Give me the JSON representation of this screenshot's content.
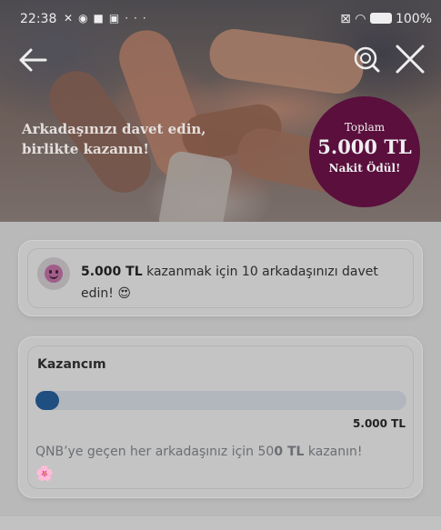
{
  "status_bar": {
    "time": "22:38",
    "notification_icons": [
      "mute-icon",
      "telegram-icon",
      "app-icon",
      "gallery-icon",
      "more-icon"
    ],
    "more": "···",
    "battery": "100"
  },
  "header": {
    "back_icon": "arrow-left-icon",
    "search_icon": "search-icon",
    "close_icon": "close-icon",
    "headline_line1": "Arkadaşınızı davet edin,",
    "headline_line2": "birlikte kazanın!"
  },
  "badge": {
    "line1": "Toplam",
    "line2": "5.000 TL",
    "line3": "Nakit Ödül!",
    "color": "#5a0f3d"
  },
  "invite_card": {
    "amount": "5.000 TL",
    "text_part1": " kazanmak için 10 arkadaşınızı davet edin! ",
    "emoji": "😍"
  },
  "earnings_card": {
    "title": "Kazancım",
    "progress_fraction": 0.06,
    "target": "5.000 TL",
    "note_prefix": "QNB’ye geçen her arkadaşınız için 50",
    "note_bold": "0 TL",
    "note_suffix": " kazanın!",
    "flower": "🌸",
    "bar_color": "#1f4f80"
  }
}
